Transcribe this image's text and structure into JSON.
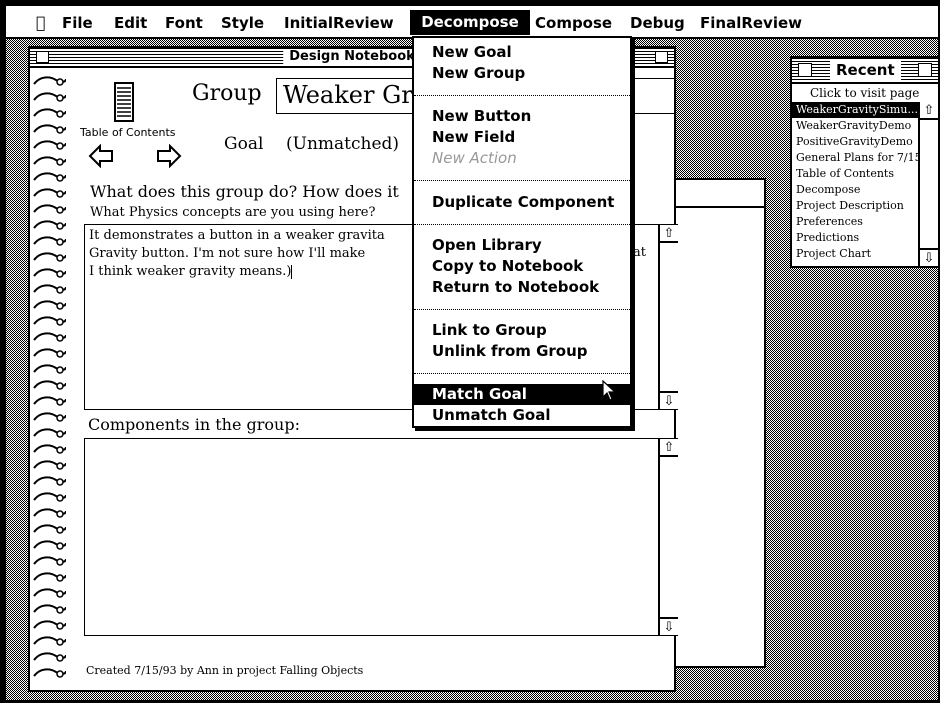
{
  "menubar": {
    "apple": "",
    "items": [
      "File",
      "Edit",
      "Font",
      "Style",
      "InitialReview",
      "Decompose",
      "Compose",
      "Debug",
      "FinalReview"
    ],
    "active": "Decompose"
  },
  "notebook": {
    "title": "Design Notebook",
    "group_label": "Group",
    "group_value": "Weaker Gr",
    "toc_label": "Table of Contents",
    "goal_label": "Goal",
    "goal_value": "(Unmatched)",
    "question1": "What does this group do?  How does it",
    "question2": "What Physics concepts are you using here?",
    "answer_line1": "It demonstrates a button in a weaker gravita",
    "answer_line2": "Gravity button.  I'm not sure how I'll make",
    "answer_line3": "I think weaker gravity means.)",
    "answer_overflow": "at",
    "components_label": "Components in the group:",
    "footer": "Created 7/15/93 by Ann in project Falling Objects"
  },
  "decompose_menu": {
    "items": [
      {
        "label": "New Goal",
        "state": "enabled"
      },
      {
        "label": "New Group",
        "state": "enabled"
      },
      {
        "label": "New Button",
        "state": "enabled"
      },
      {
        "label": "New Field",
        "state": "enabled"
      },
      {
        "label": "New Action",
        "state": "disabled"
      },
      {
        "label": "Duplicate Component",
        "state": "enabled"
      },
      {
        "label": "Open Library",
        "state": "enabled"
      },
      {
        "label": "Copy to Notebook",
        "state": "enabled"
      },
      {
        "label": "Return to Notebook",
        "state": "enabled"
      },
      {
        "label": "Link to Group",
        "state": "enabled"
      },
      {
        "label": "Unlink from Group",
        "state": "enabled"
      },
      {
        "label": "Match Goal",
        "state": "selected"
      },
      {
        "label": "Unmatch Goal",
        "state": "enabled"
      }
    ]
  },
  "recent": {
    "title": "Recent",
    "hint": "Click to visit page",
    "items": [
      "WeakerGravitySimu...",
      "WeakerGravityDemo",
      "PositiveGravityDemo",
      "General Plans for 7/15/93",
      "Table of Contents",
      "Decompose",
      "Project Description",
      "Preferences",
      "Predictions",
      "Project Chart"
    ],
    "selected_index": 0
  },
  "icons": {
    "apple": "apple-icon",
    "toc": "table-of-contents-icon",
    "back": "back-arrow-icon",
    "forward": "forward-arrow-icon",
    "cursor": "arrow-cursor-icon"
  }
}
